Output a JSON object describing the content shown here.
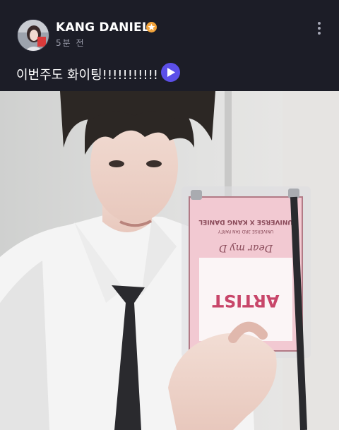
{
  "post": {
    "author": "KANG DANIEL",
    "time_ago": "5분 전",
    "caption": "이번주도 화이팅!!!!!!!!!!!",
    "verified_badge_icon": "star-badge-icon",
    "menu_icon": "more-vertical-icon",
    "play_icon": "play-icon"
  },
  "photo": {
    "lanyard_card": {
      "top_line": "UNIVERSE X KANG DANIEL",
      "sub_line": "UNIVERSE 3RD FAN PARTY",
      "script_text": "Dear my D",
      "role_text": "ARTIST"
    }
  },
  "colors": {
    "background": "#1c1d27",
    "play_button": "#5b4fe8",
    "badge": "#f2a33a",
    "timestamp": "#9b9dab"
  }
}
